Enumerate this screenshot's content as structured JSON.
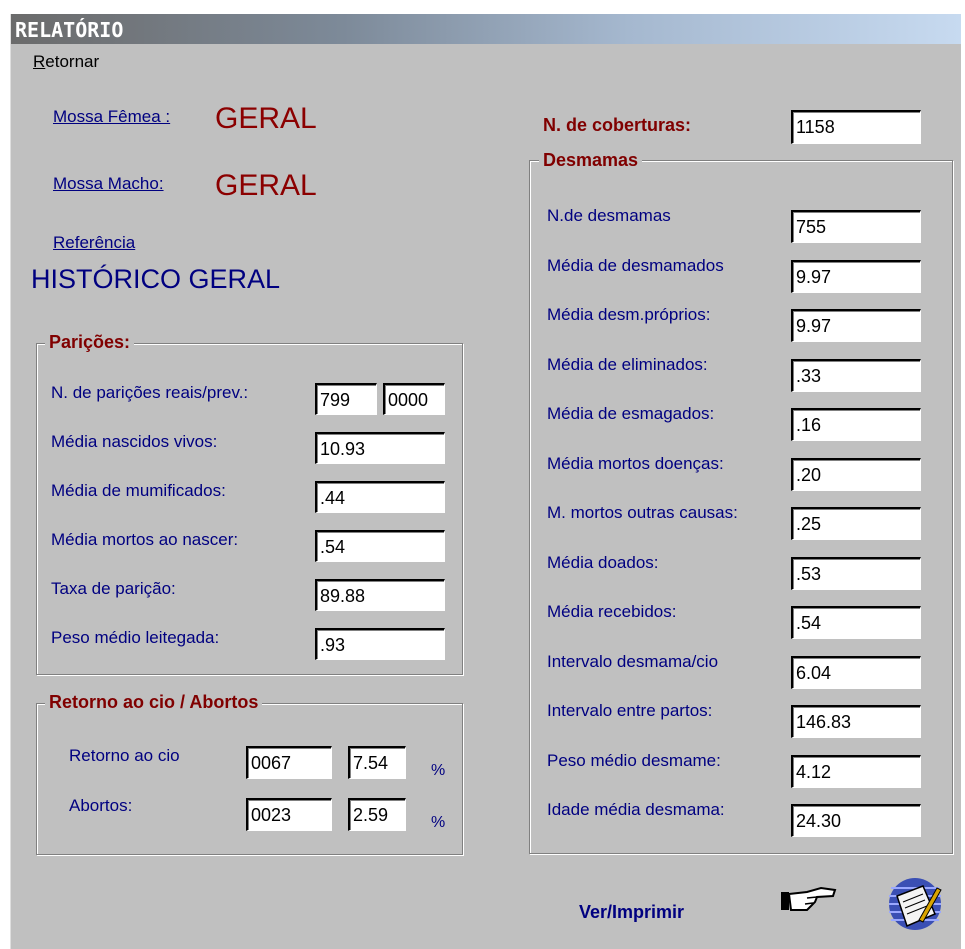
{
  "window": {
    "title": "RELATÓRIO"
  },
  "menu": {
    "retornar_prefix": "R",
    "retornar_rest": "etornar"
  },
  "filters": {
    "mossa_femea_label": "Mossa Fêmea :",
    "mossa_femea_value": "GERAL",
    "mossa_macho_label": "Mossa Macho:",
    "mossa_macho_value": "GERAL",
    "referencia_label": "Referência",
    "referencia_value": "HISTÓRICO GERAL"
  },
  "paricoes": {
    "title": "Parições:",
    "rows": [
      {
        "label": "N. de parições reais/prev.:",
        "value": "799",
        "value2": "0000"
      },
      {
        "label": "Média nascidos vivos:",
        "value": "10.93"
      },
      {
        "label": "Média de mumificados:",
        "value": ".44"
      },
      {
        "label": "Média  mortos ao nascer:",
        "value": ".54"
      },
      {
        "label": "Taxa de parição:",
        "value": "89.88"
      },
      {
        "label": "Peso médio leitegada:",
        "value": ".93"
      }
    ]
  },
  "retorno": {
    "title": "Retorno ao cio / Abortos",
    "rows": [
      {
        "label": "Retorno ao cio",
        "count": "0067",
        "percent": "7.54",
        "unit": "%"
      },
      {
        "label": "Abortos:",
        "count": "0023",
        "percent": "2.59",
        "unit": "%"
      }
    ]
  },
  "coberturas": {
    "label": "N. de coberturas:",
    "value": "1158"
  },
  "desmamas": {
    "title": "Desmamas",
    "rows": [
      {
        "label": "N.de desmamas",
        "value": "755"
      },
      {
        "label": "Média de desmamados",
        "value": "9.97"
      },
      {
        "label": "Média desm.próprios:",
        "value": "9.97"
      },
      {
        "label": "Média de eliminados:",
        "value": ".33"
      },
      {
        "label": "Média de esmagados:",
        "value": ".16"
      },
      {
        "label": "Média mortos doenças:",
        "value": ".20"
      },
      {
        "label": "M. mortos outras causas:",
        "value": ".25"
      },
      {
        "label": "Média doados:",
        "value": ".53"
      },
      {
        "label": "Média recebidos:",
        "value": ".54"
      },
      {
        "label": "Intervalo desmama/cio",
        "value": "6.04"
      },
      {
        "label": "Intervalo entre partos:",
        "value": "146.83"
      },
      {
        "label": "Peso médio desmame:",
        "value": "4.12"
      },
      {
        "label": "Idade média  desmama:",
        "value": "24.30"
      }
    ]
  },
  "actions": {
    "ver_imprimir_label": "Ver/Imprimir",
    "pointer_icon": "pointing-hand-icon",
    "report_icon": "report-notepad-icon"
  }
}
